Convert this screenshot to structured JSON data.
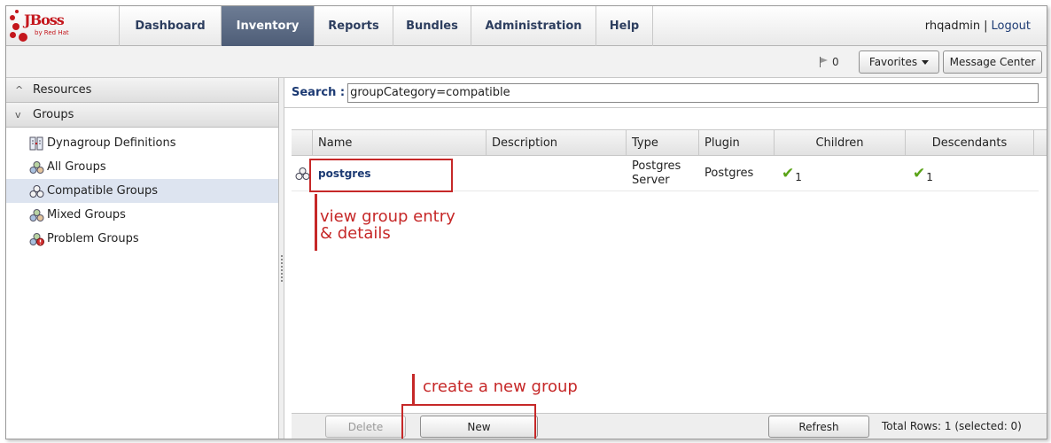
{
  "logo": {
    "brand": "JBoss",
    "byline": "by Red Hat"
  },
  "nav": {
    "tabs": [
      {
        "label": "Dashboard",
        "active": false
      },
      {
        "label": "Inventory",
        "active": true
      },
      {
        "label": "Reports",
        "active": false
      },
      {
        "label": "Bundles",
        "active": false
      },
      {
        "label": "Administration",
        "active": false
      },
      {
        "label": "Help",
        "active": false
      }
    ],
    "user": "rhqadmin",
    "separator": "|",
    "logout": "Logout"
  },
  "message_bar": {
    "flag_count": "0",
    "favorites_label": "Favorites",
    "message_center_label": "Message Center"
  },
  "sidebar": {
    "resources_label": "Resources",
    "groups_label": "Groups",
    "resources_chevron": "^",
    "groups_chevron": "v",
    "items": [
      {
        "label": "Dynagroup Definitions",
        "icon": "dynagroup-icon",
        "selected": false
      },
      {
        "label": "All Groups",
        "icon": "all-groups-icon",
        "selected": false
      },
      {
        "label": "Compatible Groups",
        "icon": "compatible-groups-icon",
        "selected": true
      },
      {
        "label": "Mixed Groups",
        "icon": "mixed-groups-icon",
        "selected": false
      },
      {
        "label": "Problem Groups",
        "icon": "problem-groups-icon",
        "selected": false
      }
    ]
  },
  "search": {
    "label": "Search :",
    "value": "groupCategory=compatible"
  },
  "table": {
    "columns": [
      "Name",
      "Description",
      "Type",
      "Plugin",
      "Children",
      "Descendants"
    ],
    "rows": [
      {
        "name": "postgres",
        "description": "",
        "type_line1": "Postgres",
        "type_line2": "Server",
        "plugin": "Postgres",
        "children_count": "1",
        "descendants_count": "1",
        "children_status": "up",
        "descendants_status": "up"
      }
    ]
  },
  "toolbar": {
    "delete_label": "Delete",
    "new_label": "New",
    "refresh_label": "Refresh",
    "total_rows": "Total Rows: 1 (selected: 0)"
  },
  "annotations": {
    "group_entry_line1": "view group entry",
    "group_entry_line2": "& details",
    "new_group": "create a new group"
  },
  "colors": {
    "accent": "#c62828",
    "nav_active": "#5a6982",
    "link": "#1c3a73",
    "check": "#5aa317",
    "brand": "#c4161c"
  }
}
